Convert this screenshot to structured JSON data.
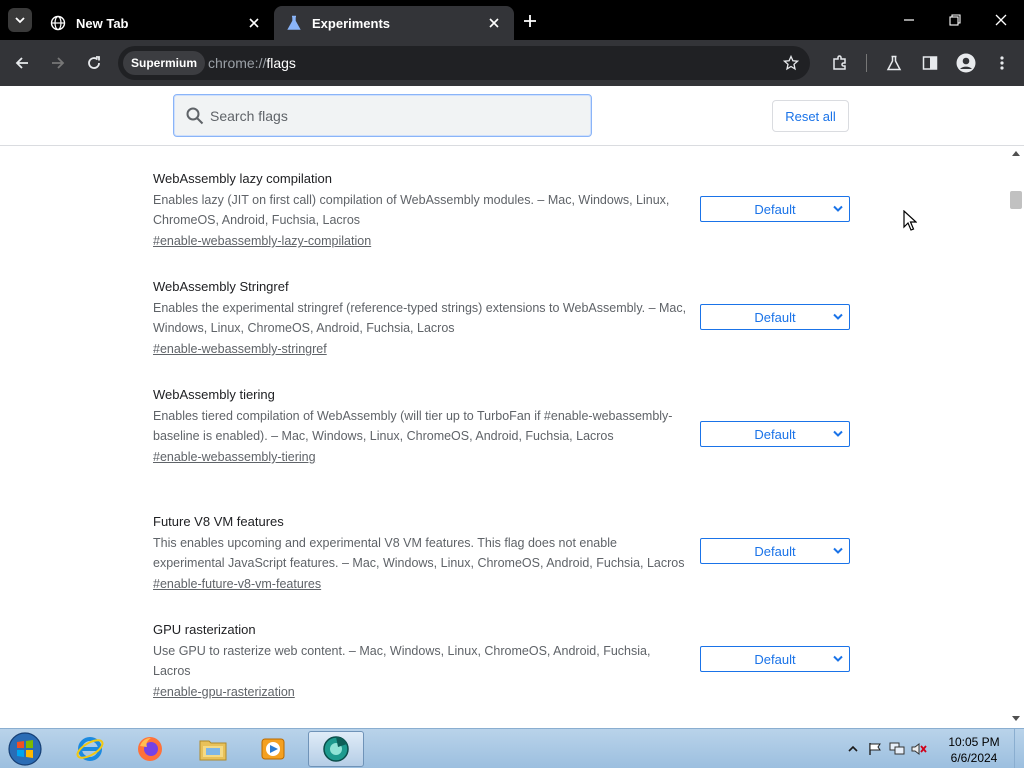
{
  "tabs": [
    {
      "title": "New Tab",
      "icon": "globe-icon"
    },
    {
      "title": "Experiments",
      "icon": "flask-icon"
    }
  ],
  "toolbar": {
    "chip_label": "Supermium",
    "url_scheme": "chrome://",
    "url_host": "flags"
  },
  "header": {
    "search_placeholder": "Search flags",
    "reset_label": "Reset all"
  },
  "flags": [
    {
      "name": "WebAssembly lazy compilation",
      "description": "Enables lazy (JIT on first call) compilation of WebAssembly modules. – Mac, Windows, Linux, ChromeOS, Android, Fuchsia, Lacros",
      "link": "#enable-webassembly-lazy-compilation",
      "value": "Default"
    },
    {
      "name": "WebAssembly Stringref",
      "description": "Enables the experimental stringref (reference-typed strings) extensions to WebAssembly. – Mac, Windows, Linux, ChromeOS, Android, Fuchsia, Lacros",
      "link": "#enable-webassembly-stringref",
      "value": "Default"
    },
    {
      "name": "WebAssembly tiering",
      "description": "Enables tiered compilation of WebAssembly (will tier up to TurboFan if #enable-webassembly-baseline is enabled). – Mac, Windows, Linux, ChromeOS, Android, Fuchsia, Lacros",
      "link": "#enable-webassembly-tiering",
      "value": "Default"
    },
    {
      "name": "Future V8 VM features",
      "description": "This enables upcoming and experimental V8 VM features. This flag does not enable experimental JavaScript features. – Mac, Windows, Linux, ChromeOS, Android, Fuchsia, Lacros",
      "link": "#enable-future-v8-vm-features",
      "value": "Default"
    },
    {
      "name": "GPU rasterization",
      "description": "Use GPU to rasterize web content. – Mac, Windows, Linux, ChromeOS, Android, Fuchsia, Lacros",
      "link": "#enable-gpu-rasterization",
      "value": "Default"
    }
  ],
  "taskbar": {
    "apps": [
      "internet-explorer-icon",
      "firefox-icon",
      "file-explorer-icon",
      "media-player-icon",
      "supermium-icon"
    ],
    "clock_time": "10:05 PM",
    "clock_date": "6/6/2024"
  },
  "colors": {
    "accent": "#1a73e8",
    "tabstrip": "#000000",
    "toolbar": "#333438"
  }
}
